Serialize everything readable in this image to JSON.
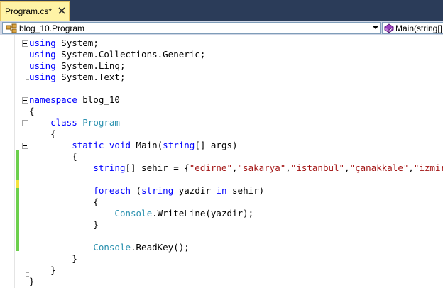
{
  "tab": {
    "title": "Program.cs*",
    "close_icon": "close-icon"
  },
  "nav": {
    "class_combo": "blog_10.Program",
    "member_combo": "Main(string[] args)"
  },
  "code": {
    "l1": [
      "using",
      " System;"
    ],
    "l2": [
      "using",
      " System.Collections.Generic;"
    ],
    "l3": [
      "using",
      " System.Linq;"
    ],
    "l4": [
      "using",
      " System.Text;"
    ],
    "l6": [
      "namespace",
      " blog_10"
    ],
    "l7": "{",
    "l8": [
      "    ",
      "class",
      " ",
      "Program"
    ],
    "l9": "    {",
    "l10": [
      "        ",
      "static",
      " ",
      "void",
      " Main(",
      "string",
      "[] args)"
    ],
    "l11": "        {",
    "l12": [
      "            ",
      "string",
      "[] sehir = {",
      "\"edirne\"",
      ",",
      "\"sakarya\"",
      ",",
      "\"istanbul\"",
      ",",
      "\"çanakkale\"",
      ",",
      "\"izmir\"",
      "};"
    ],
    "l14": [
      "            ",
      "foreach",
      " (",
      "string",
      " yazdir ",
      "in",
      " sehir)"
    ],
    "l15": "            {",
    "l16": [
      "                ",
      "Console",
      ".WriteLine(yazdir);"
    ],
    "l17": "            }",
    "l19": [
      "            ",
      "Console",
      ".ReadKey();"
    ],
    "l20": "        }",
    "l21": "    }",
    "l22": "}"
  },
  "colors": {
    "keyword": "#0000ff",
    "type": "#2b91af",
    "string": "#a31515",
    "tab_active": "#fff3a6",
    "saved_change": "#6ccf4c",
    "unsaved_change": "#f4e33c"
  }
}
